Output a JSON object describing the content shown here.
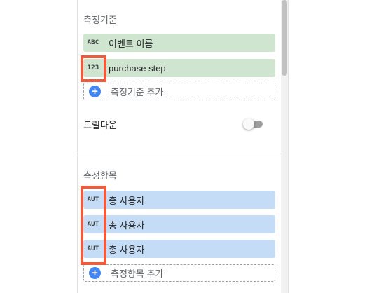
{
  "dimensions": {
    "title": "측정기준",
    "chips": [
      {
        "type_badge": "ABC",
        "label": "이벤트 이름"
      },
      {
        "type_badge": "123",
        "label": "purchase step"
      }
    ],
    "add_label": "측정기준 추가"
  },
  "drilldown": {
    "label": "드릴다운",
    "enabled": false
  },
  "metrics": {
    "title": "측정항목",
    "chips": [
      {
        "type_badge": "AUT",
        "label": "총 사용자"
      },
      {
        "type_badge": "AUT",
        "label": "총 사용자"
      },
      {
        "type_badge": "AUT",
        "label": "총 사용자"
      }
    ],
    "add_label": "측정항목 추가"
  },
  "colors": {
    "dimension_chip": "#cfe5cf",
    "metric_chip": "#c4dcf5",
    "highlight_border": "#ef5b3d",
    "add_icon": "#4285f4"
  }
}
